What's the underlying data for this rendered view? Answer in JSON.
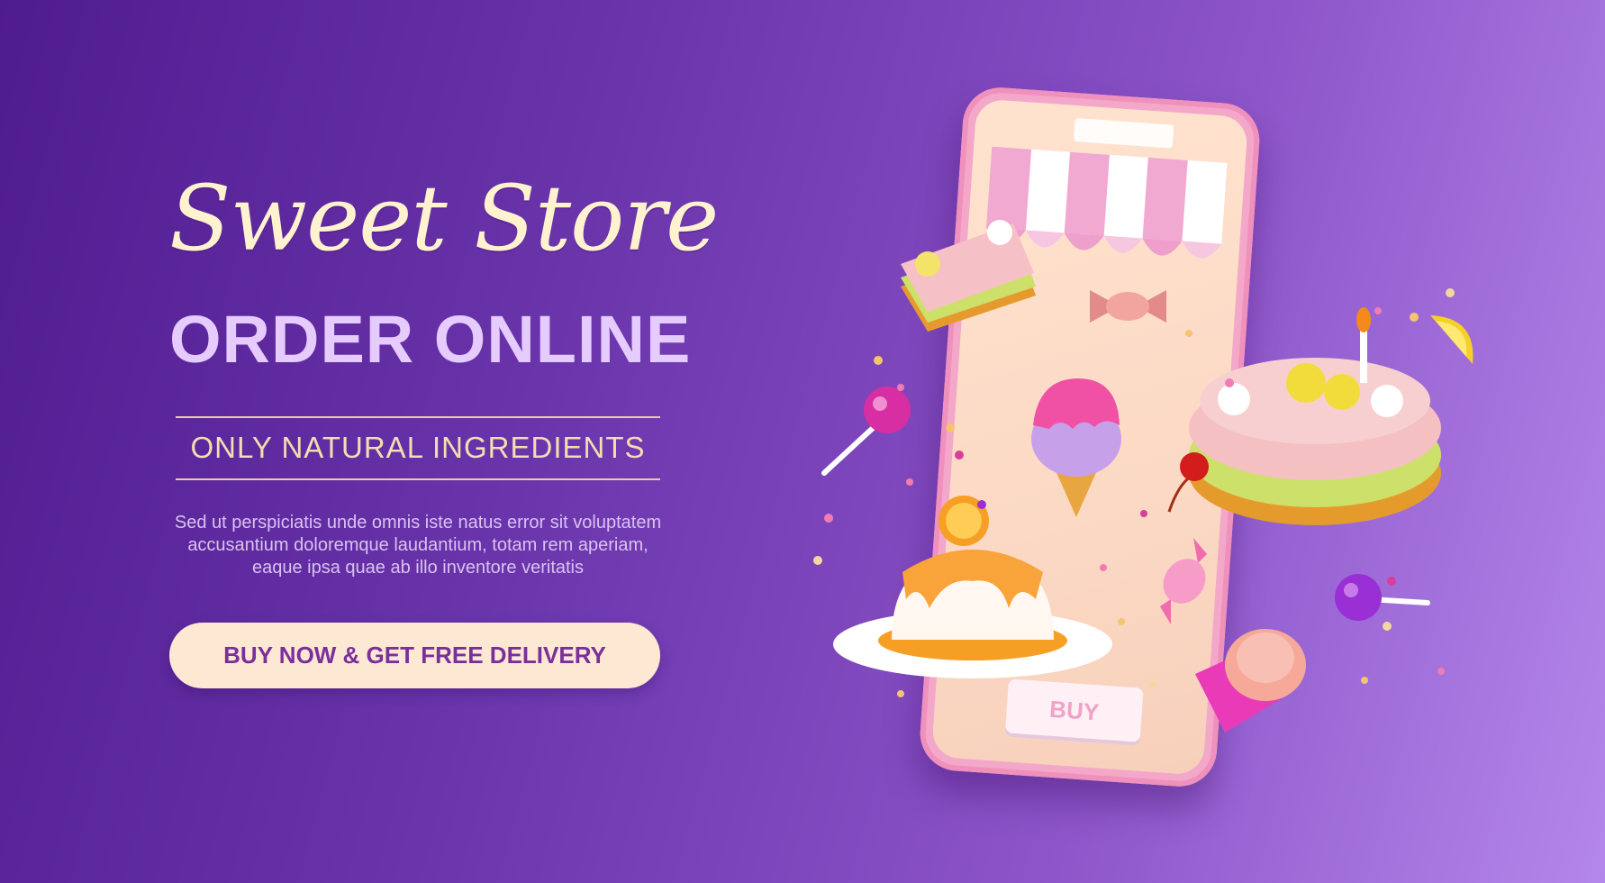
{
  "hero": {
    "script_title": "Sweet Store",
    "bold_title": "ORDER ONLINE",
    "subtitle": "ONLY NATURAL INGREDIENTS",
    "body": "Sed ut perspiciatis unde omnis iste natus error sit voluptatem accusantium doloremque laudantium, totam rem aperiam, eaque ipsa quae ab illo inventore veritatis",
    "cta_label": "BUY NOW & GET FREE DELIVERY"
  },
  "phone": {
    "buy_label": "BUY"
  },
  "colors": {
    "bg_start": "#4f1c8f",
    "bg_end": "#b487ea",
    "script_title": "#fff3cf",
    "bold_title": "#e6cbff",
    "cta_bg": "#fde8d4",
    "cta_text": "#7a2f9a",
    "phone_frame": "#f4a8c9"
  },
  "icons": [
    "awning-icon",
    "cake-slice-icon",
    "candy-icon",
    "ice-cream-icon",
    "lollipop-icon",
    "pudding-icon",
    "birthday-cake-icon",
    "lemon-slice-icon",
    "cherry-icon",
    "cupcake-icon"
  ]
}
